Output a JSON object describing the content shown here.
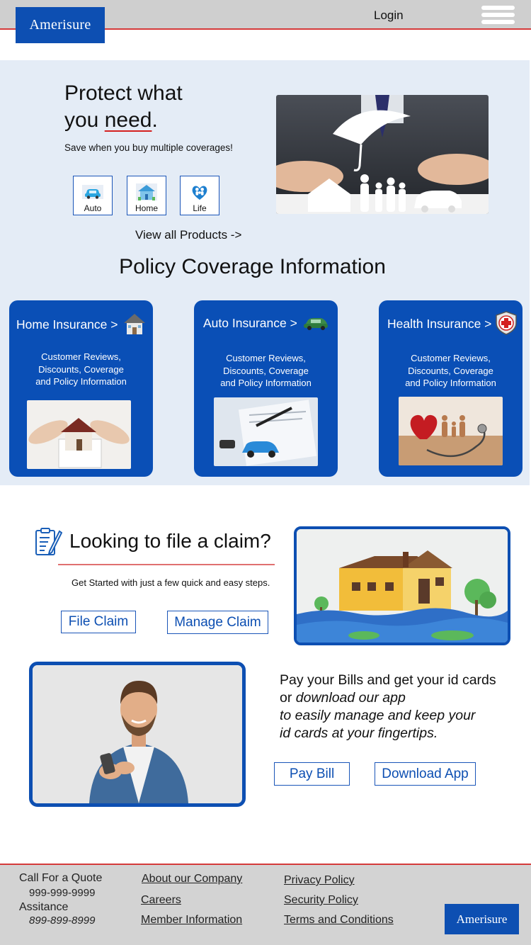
{
  "header": {
    "brand": "Amerisure",
    "login_label": "Login",
    "menu_icon": "hamburger-menu-icon"
  },
  "hero": {
    "title_line1": "Protect what",
    "title_line2_pre": "you ",
    "title_line2_emph": "need",
    "title_line2_post": ".",
    "subtitle": "Save when you buy multiple coverages!",
    "products": [
      {
        "label": "Auto",
        "icon": "car-icon"
      },
      {
        "label": "Home",
        "icon": "house-icon"
      },
      {
        "label": "Life",
        "icon": "family-heart-icon"
      }
    ],
    "view_all_label": "View all Products ->"
  },
  "coverage": {
    "title": "Policy Coverage Information",
    "cards": [
      {
        "title": "Home Insurance >",
        "desc_lines": [
          "Customer Reviews,",
          "Discounts, Coverage",
          "and Policy Information"
        ],
        "icon": "house-icon"
      },
      {
        "title": "Auto Insurance >",
        "desc_lines": [
          "Customer Reviews,",
          "Discounts, Coverage",
          "and Policy Information"
        ],
        "icon": "car-icon"
      },
      {
        "title": "Health Insurance >",
        "desc_lines": [
          "Customer Reviews,",
          "Discounts, Coverage",
          "and Policy Information"
        ],
        "icon": "medical-shield-icon"
      }
    ]
  },
  "claim": {
    "title": "Looking to file a claim?",
    "subtitle": "Get Started with just a few quick and easy steps.",
    "file_label": "File Claim",
    "manage_label": "Manage Claim"
  },
  "bills": {
    "line1": "Pay your Bills and get your id cards",
    "line2_pre": "or ",
    "line2_emph": "download our app",
    "line3": "to easily manage and keep your",
    "line4": "id cards at your fingertips.",
    "pay_label": "Pay Bill",
    "download_label": "Download App"
  },
  "footer": {
    "quote_label": "Call For a Quote",
    "quote_phone": "999-999-9999",
    "assist_label": "Assitance",
    "assist_phone": "899-899-8999",
    "col2": [
      "About our Company",
      "Careers",
      "Member Information"
    ],
    "col3": [
      "Privacy Policy",
      "Security Policy",
      "Terms and Conditions"
    ],
    "brand": "Amerisure"
  }
}
